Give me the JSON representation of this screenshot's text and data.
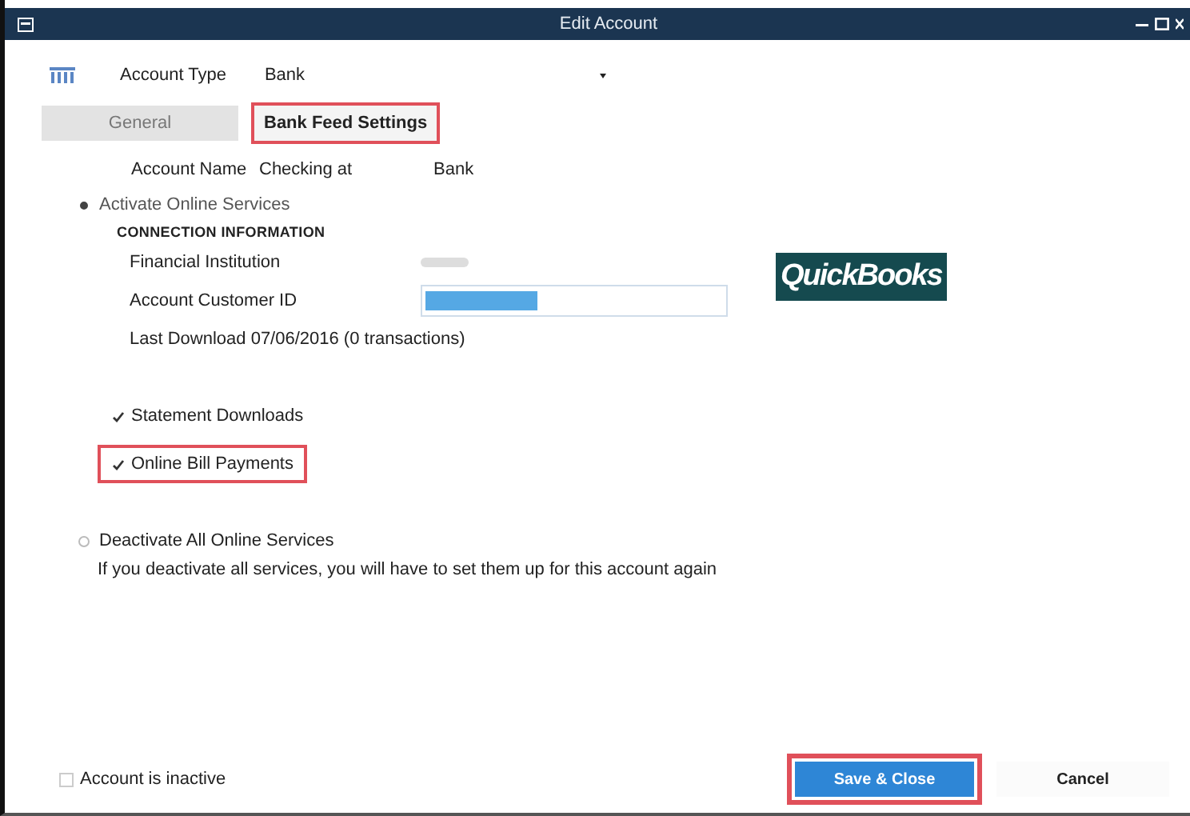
{
  "window": {
    "title": "Edit Account"
  },
  "account_type": {
    "label": "Account Type",
    "value": "Bank"
  },
  "tabs": [
    {
      "label": "General",
      "selected": false,
      "highlighted": false
    },
    {
      "label": "Bank Feed Settings",
      "selected": true,
      "highlighted": true
    }
  ],
  "account_name": {
    "label": "Account Name",
    "value_1": "Checking at",
    "value_2": "Bank"
  },
  "activate_option": {
    "label": "Activate Online Services",
    "selected": true
  },
  "connection": {
    "heading": "CONNECTION INFORMATION",
    "financial_institution_label": "Financial Institution",
    "customer_id_label": "Account Customer ID",
    "last_download": "Last Download  07/06/2016 (0 transactions)"
  },
  "logo": {
    "text": "QuickBooks"
  },
  "services": [
    {
      "label": "Statement Downloads",
      "checked": true,
      "highlighted": false
    },
    {
      "label": "Online Bill Payments",
      "checked": true,
      "highlighted": true
    }
  ],
  "deactivate_option": {
    "label": "Deactivate All Online Services",
    "selected": false,
    "note": "If you deactivate all services, you will have to set them up for this account again"
  },
  "inactive": {
    "label": "Account is inactive",
    "checked": false
  },
  "buttons": [
    {
      "label": "Save & Close",
      "kind": "primary",
      "highlighted": true
    },
    {
      "label": "Cancel",
      "kind": "secondary",
      "highlighted": false
    }
  ]
}
